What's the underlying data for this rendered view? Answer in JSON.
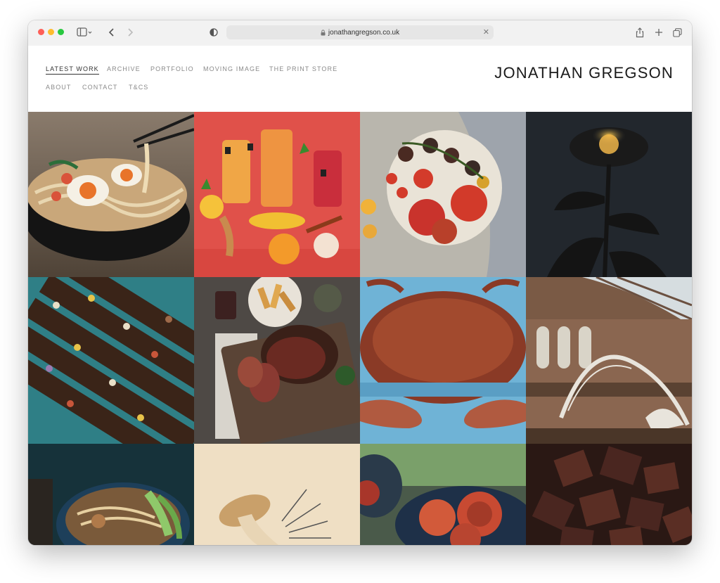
{
  "browser": {
    "url": "jonathangregson.co.uk",
    "traffic_lights": [
      "#fe5f57",
      "#febc2e",
      "#28c840"
    ]
  },
  "site": {
    "title": "JONATHAN GREGSON",
    "nav": [
      {
        "label": "LATEST WORK",
        "active": true
      },
      {
        "label": "ARCHIVE"
      },
      {
        "label": "PORTFOLIO"
      },
      {
        "label": "MOVING IMAGE"
      },
      {
        "label": "THE PRINT STORE"
      },
      {
        "label": "ABOUT"
      },
      {
        "label": "CONTACT"
      },
      {
        "label": "T&CS"
      }
    ]
  },
  "gallery": [
    {
      "subject": "ramen bowl with chopsticks"
    },
    {
      "subject": "iced tea glasses with fruit on red background"
    },
    {
      "subject": "plate of tomatoes on the vine"
    },
    {
      "subject": "dark flower silhouette"
    },
    {
      "subject": "chocolate bark slices on teal"
    },
    {
      "subject": "roast beef on board"
    },
    {
      "subject": "crab on blue background"
    },
    {
      "subject": "natural history museum hall with whale skeleton"
    },
    {
      "subject": "noodle bowl with pak choi"
    },
    {
      "subject": "mushroom on cream background"
    },
    {
      "subject": "bowls of figs"
    },
    {
      "subject": "chocolate pieces"
    }
  ]
}
